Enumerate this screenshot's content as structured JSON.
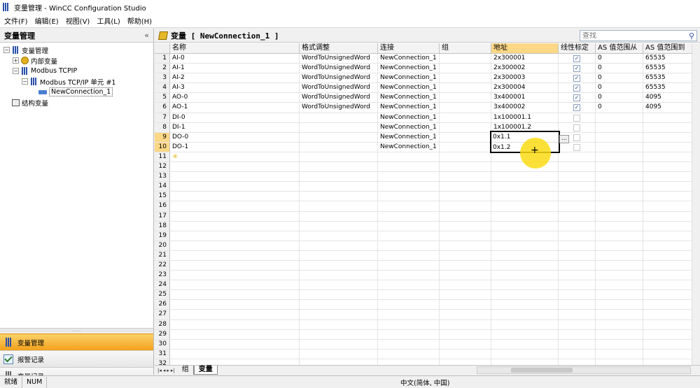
{
  "window": {
    "title": "变量管理 - WinCC Configuration Studio"
  },
  "menu": [
    "文件(F)",
    "编辑(E)",
    "视图(V)",
    "工具(L)",
    "帮助(H)"
  ],
  "left": {
    "title": "变量管理",
    "collapse_glyph": "«",
    "tree": [
      {
        "label": "变量管理",
        "icon": "bars-icon",
        "exp": "−",
        "indent": 0
      },
      {
        "label": "内部变量",
        "icon": "internal-tags-icon",
        "exp": "+",
        "indent": 1
      },
      {
        "label": "Modbus TCPIP",
        "icon": "bars-icon",
        "exp": "−",
        "indent": 1
      },
      {
        "label": "Modbus TCP/IP 单元 #1",
        "icon": "bars-icon",
        "exp": "−",
        "indent": 2
      },
      {
        "label": "NewConnection_1",
        "icon": "connection-icon",
        "exp": "",
        "indent": 3,
        "selected": true
      },
      {
        "label": "结构变量",
        "icon": "struct-icon",
        "exp": "",
        "indent": 0
      }
    ],
    "nav": [
      {
        "label": "变量管理",
        "icon": "tag-management-icon",
        "active": true
      },
      {
        "label": "报警记录",
        "icon": "alarm-logging-icon",
        "active": false
      },
      {
        "label": "变量记录",
        "icon": "tag-logging-icon",
        "active": false
      }
    ],
    "toolbar_glyphs": [
      "▥",
      "▦",
      "▤",
      "◂",
      "⚙",
      "⊞",
      "▾"
    ]
  },
  "main": {
    "title": "变量 [ NewConnection_1 ]",
    "search_placeholder": "查找",
    "columns": [
      "名称",
      "格式调整",
      "连接",
      "组",
      "地址",
      "线性标定",
      "AS 值范围从",
      "AS 值范围到"
    ],
    "rows": [
      {
        "n": "1",
        "name": "AI-0",
        "fmt": "WordToUnsignedWord",
        "conn": "NewConnection_1",
        "grp": "",
        "addr": "2x300001",
        "lin": true,
        "asf": "0",
        "ast": "65535"
      },
      {
        "n": "2",
        "name": "AI-1",
        "fmt": "WordToUnsignedWord",
        "conn": "NewConnection_1",
        "grp": "",
        "addr": "2x300002",
        "lin": true,
        "asf": "0",
        "ast": "65535"
      },
      {
        "n": "3",
        "name": "AI-2",
        "fmt": "WordToUnsignedWord",
        "conn": "NewConnection_1",
        "grp": "",
        "addr": "2x300003",
        "lin": true,
        "asf": "0",
        "ast": "65535"
      },
      {
        "n": "4",
        "name": "AI-3",
        "fmt": "WordToUnsignedWord",
        "conn": "NewConnection_1",
        "grp": "",
        "addr": "2x300004",
        "lin": true,
        "asf": "0",
        "ast": "65535"
      },
      {
        "n": "5",
        "name": "AO-0",
        "fmt": "WordToUnsignedWord",
        "conn": "NewConnection_1",
        "grp": "",
        "addr": "3x400001",
        "lin": true,
        "asf": "0",
        "ast": "4095"
      },
      {
        "n": "6",
        "name": "AO-1",
        "fmt": "WordToUnsignedWord",
        "conn": "NewConnection_1",
        "grp": "",
        "addr": "3x400002",
        "lin": true,
        "asf": "0",
        "ast": "4095"
      },
      {
        "n": "7",
        "name": "DI-0",
        "fmt": "",
        "conn": "NewConnection_1",
        "grp": "",
        "addr": "1x100001.1",
        "lin": false,
        "asf": "",
        "ast": ""
      },
      {
        "n": "8",
        "name": "DI-1",
        "fmt": "",
        "conn": "NewConnection_1",
        "grp": "",
        "addr": "1x100001.2",
        "lin": false,
        "asf": "",
        "ast": ""
      },
      {
        "n": "9",
        "name": "DO-0",
        "fmt": "",
        "conn": "NewConnection_1",
        "grp": "",
        "addr": "0x1.1",
        "lin": false,
        "asf": "",
        "ast": "",
        "hl": true
      },
      {
        "n": "10",
        "name": "DO-1",
        "fmt": "",
        "conn": "NewConnection_1",
        "grp": "",
        "addr": "0x1.2",
        "lin": false,
        "asf": "",
        "ast": "",
        "hl": true
      }
    ],
    "empty_rows": [
      "11",
      "12",
      "13",
      "14",
      "15",
      "16",
      "17",
      "18",
      "19",
      "20",
      "21",
      "22",
      "23",
      "24",
      "25",
      "26",
      "27",
      "28",
      "29",
      "30",
      "31",
      "32"
    ],
    "new_row_glyph": "✳",
    "ellipsis": "...",
    "check_glyph": "✓",
    "tab_nav": [
      "|◂",
      "◂",
      "▸",
      "▸|"
    ],
    "sheet_tabs": [
      {
        "label": "组",
        "active": false
      },
      {
        "label": "变量",
        "active": true
      }
    ]
  },
  "status": {
    "ready": "就绪",
    "num": "NUM",
    "locale": "中文(简体, 中国)"
  }
}
